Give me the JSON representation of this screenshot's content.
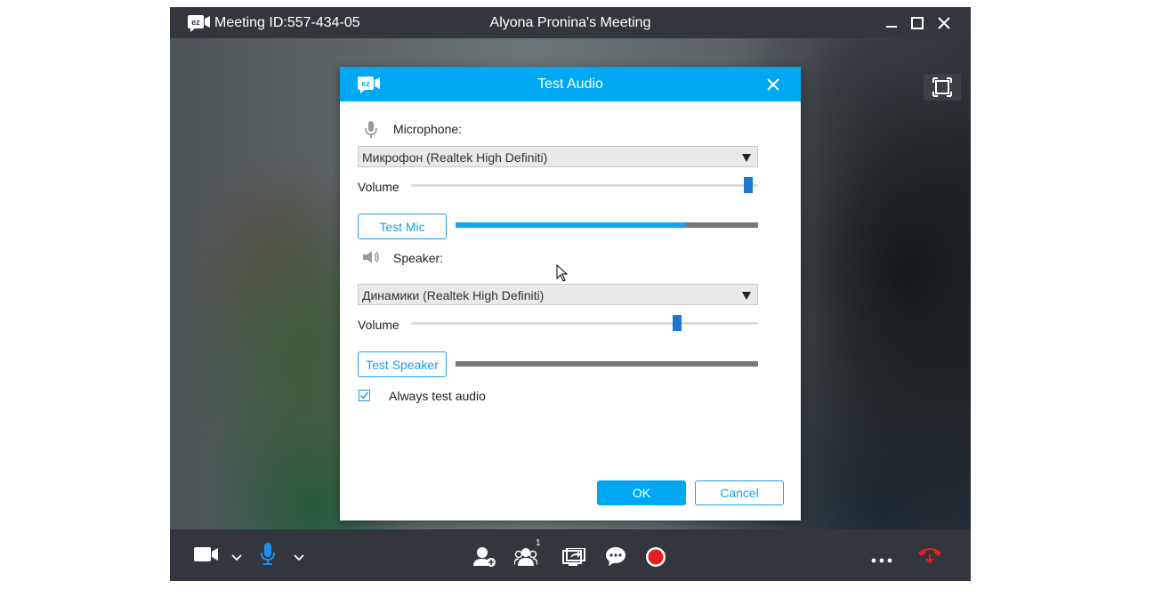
{
  "window": {
    "meeting_id": "Meeting ID:557-434-05",
    "title": "Alyona Pronina's Meeting"
  },
  "dialog": {
    "logo_text": "ez",
    "title": "Test Audio",
    "microphone": {
      "label": "Microphone:",
      "device": "Микрофон (Realtek High Definiti)",
      "volume_label": "Volume",
      "volume_level": 1.0,
      "test_button": "Test Mic",
      "input_level": 0.76
    },
    "speaker": {
      "label": "Speaker:",
      "device": "Динамики (Realtek High Definiti)",
      "volume_label": "Volume",
      "volume_level": 0.79,
      "test_button": "Test Speaker",
      "output_level": 0.0
    },
    "always_test": {
      "label": "Always test audio",
      "checked": true
    },
    "ok_label": "OK",
    "cancel_label": "Cancel"
  },
  "toolbar": {
    "participants_count": "1",
    "colors": {
      "mic_active": "#1a90e8",
      "record": "#e02020",
      "hangup": "#e02020"
    }
  },
  "colors": {
    "accent": "#00a8f3",
    "titlebar": "#33373d"
  }
}
